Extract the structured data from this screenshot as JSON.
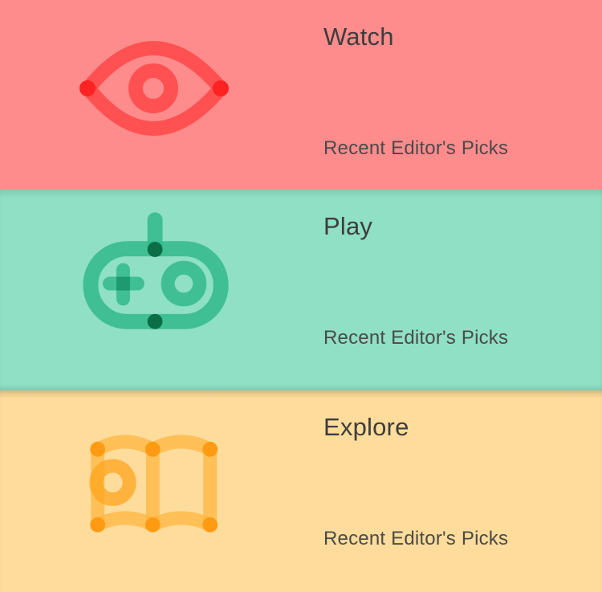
{
  "cards": [
    {
      "title": "Watch",
      "subtitle": "Recent Editor's Picks",
      "icon": "eye-icon",
      "background": "#ff8c8c",
      "accent": "#ff3b3b"
    },
    {
      "title": "Play",
      "subtitle": "Recent Editor's Picks",
      "icon": "gamepad-icon",
      "background": "#8fe0c4",
      "accent": "#2fb88a"
    },
    {
      "title": "Explore",
      "subtitle": "Recent Editor's Picks",
      "icon": "open-book-icon",
      "background": "#fedc9b",
      "accent": "#ffa826"
    }
  ]
}
